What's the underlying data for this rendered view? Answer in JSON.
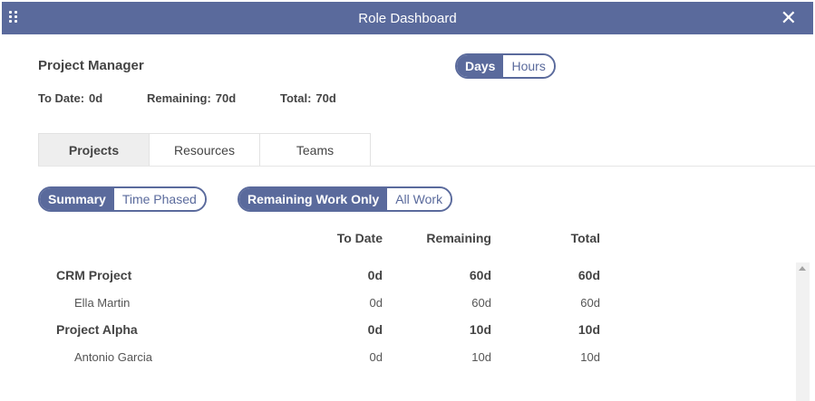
{
  "window": {
    "title": "Role Dashboard"
  },
  "role": "Project Manager",
  "unit_toggle": {
    "days": "Days",
    "hours": "Hours",
    "selected": "Days"
  },
  "stats": {
    "to_date_label": "To Date:",
    "to_date": "0d",
    "remaining_label": "Remaining:",
    "remaining": "70d",
    "total_label": "Total:",
    "total": "70d"
  },
  "tabs": [
    "Projects",
    "Resources",
    "Teams"
  ],
  "active_tab": "Projects",
  "view_toggle": {
    "summary": "Summary",
    "time_phased": "Time Phased",
    "selected": "Summary"
  },
  "work_toggle": {
    "remaining": "Remaining Work Only",
    "all": "All Work",
    "selected": "Remaining Work Only"
  },
  "table": {
    "headers": {
      "to_date": "To Date",
      "remaining": "Remaining",
      "total": "Total"
    },
    "rows": [
      {
        "name": "CRM Project",
        "to_date": "0d",
        "remaining": "60d",
        "total": "60d"
      },
      {
        "name": "Ella Martin",
        "to_date": "0d",
        "remaining": "60d",
        "total": "60d"
      },
      {
        "name": "Project Alpha",
        "to_date": "0d",
        "remaining": "10d",
        "total": "10d"
      },
      {
        "name": "Antonio Garcia",
        "to_date": "0d",
        "remaining": "10d",
        "total": "10d"
      }
    ]
  },
  "colors": {
    "accent": "#5a6a9c",
    "active_tab_bg": "#eeeeee"
  }
}
